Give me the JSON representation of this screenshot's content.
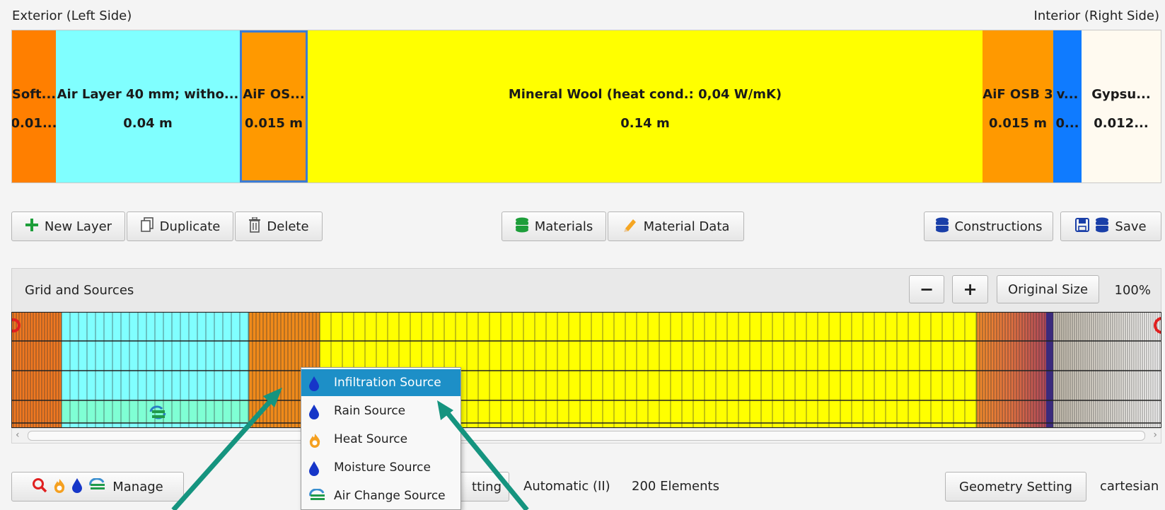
{
  "header": {
    "exterior_label": "Exterior (Left Side)",
    "interior_label": "Interior (Right Side)"
  },
  "layers": [
    {
      "name": "Soft...",
      "thickness": "0.01...",
      "color": "#ff7f00"
    },
    {
      "name": "Air Layer 40 mm; witho...",
      "thickness": "0.04 m",
      "color": "#80ffff"
    },
    {
      "name": "AiF OS...",
      "thickness": "0.015 m",
      "color": "#ff9900"
    },
    {
      "name": "Mineral Wool (heat cond.: 0,04 W/mK)",
      "thickness": "0.14 m",
      "color": "#ffff00"
    },
    {
      "name": "AiF OSB 3",
      "thickness": "0.015 m",
      "color": "#ff9900"
    },
    {
      "name": "v...",
      "thickness": "0...",
      "color": "#0f7bff"
    },
    {
      "name": "Gypsu...",
      "thickness": "0.012...",
      "color": "#fffaf0"
    }
  ],
  "toolbar": {
    "new_layer": "New Layer",
    "duplicate": "Duplicate",
    "delete": "Delete",
    "materials": "Materials",
    "material_data": "Material Data",
    "constructions": "Constructions",
    "save": "Save"
  },
  "grid_panel": {
    "title": "Grid and Sources",
    "zoom_out": "−",
    "zoom_in": "+",
    "original_size": "Original Size",
    "zoom": "100%"
  },
  "bottom_bar": {
    "manage": "Manage",
    "grid_setting_partial": "tting",
    "grid_mode": "Automatic (II)",
    "elements": "200 Elements",
    "geometry_setting": "Geometry Setting",
    "geometry_type": "cartesian"
  },
  "context_menu": {
    "items": [
      {
        "label": "Infiltration Source",
        "icon": "water-drop-icon",
        "highlighted": true
      },
      {
        "label": "Rain Source",
        "icon": "water-drop-icon"
      },
      {
        "label": "Heat Source",
        "icon": "flame-icon"
      },
      {
        "label": "Moisture Source",
        "icon": "water-drop-icon"
      },
      {
        "label": "Air Change Source",
        "icon": "air-change-icon"
      }
    ]
  },
  "colors": {
    "accent_green": "#1d9e3a",
    "menu_highlight": "#1d8fc7",
    "annotation_arrow": "#15947f",
    "selection_border": "#3a7bd5"
  }
}
